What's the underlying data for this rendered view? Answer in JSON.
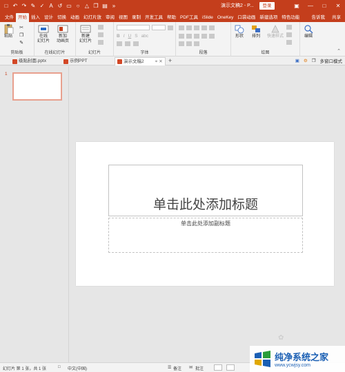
{
  "titlebar": {
    "doc_title": "演示文稿2 - P...",
    "login": "登录",
    "qat_icons": [
      "save-icon",
      "undo-icon",
      "redo-icon",
      "format-painter-icon",
      "spellcheck-icon",
      "font-a-icon",
      "undo-arrow-icon",
      "shape-icon",
      "circle-icon",
      "triangle-icon",
      "copy-icon",
      "text-box-icon",
      "more-icon"
    ]
  },
  "tabs": [
    "文件",
    "开始",
    "插入",
    "设计",
    "切换",
    "动画",
    "幻灯片放",
    "审阅",
    "视图",
    "录制",
    "开发工具",
    "帮助",
    "PDF工具",
    "iSlide",
    "OneKey",
    "口袋动画",
    "新建选项",
    "特色功能"
  ],
  "active_tab": "开始",
  "tell_me": "告诉我",
  "share": "共享",
  "ribbon": {
    "clipboard": {
      "paste": "粘贴",
      "label": "剪贴板"
    },
    "new_slide_group": {
      "online": "在线",
      "online2": "幻灯片",
      "add": "新加",
      "add2": "动画页",
      "label": "在线幻灯片"
    },
    "slides": {
      "new": "新建",
      "new2": "幻灯片",
      "label": "幻灯片"
    },
    "font": {
      "label": "字体",
      "bold": "B",
      "italic": "I",
      "underline": "U",
      "strike": "S",
      "abc": "abc"
    },
    "paragraph": {
      "label": "段落"
    },
    "drawing": {
      "shapes": "形状",
      "arrange": "排列",
      "quick_styles": "快速样式",
      "label": "绘图"
    },
    "editing": {
      "edit": "编辑"
    }
  },
  "doc_tabs": [
    "级贴封面.pptx",
    "示例PPT",
    "演示文稿2"
  ],
  "active_doc_tab": "演示文稿2",
  "multi_window": "多窗口模式",
  "slide_panel": {
    "number": "1"
  },
  "slide": {
    "title_placeholder": "单击此处添加标题",
    "subtitle_placeholder": "单击此处添加副标题"
  },
  "status": {
    "slide_info": "幻灯片 第 1 张，共 1 张",
    "language": "中文(中国)",
    "notes": "备注",
    "comments": "批注"
  },
  "watermark": {
    "name": "纯净系统之家",
    "url": "www.ycwjsy.com"
  },
  "colors": {
    "accent": "#c43e1c",
    "watermark": "#1a5fb4"
  }
}
